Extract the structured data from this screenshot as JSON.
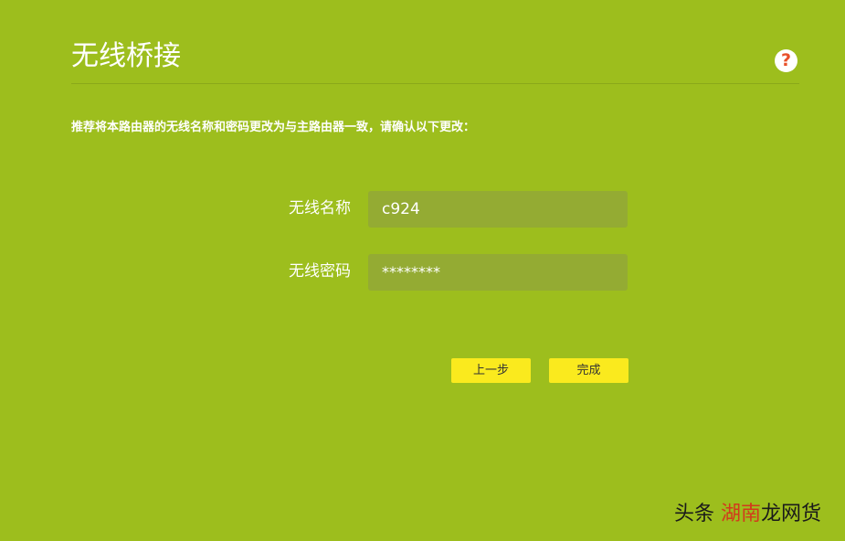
{
  "header": {
    "title": "无线桥接",
    "help_icon": "?"
  },
  "instruction": "推荐将本路由器的无线名称和密码更改为与主路由器一致，请确认以下更改：",
  "form": {
    "ssid_label": "无线名称",
    "ssid_value": "c924",
    "password_label": "无线密码",
    "password_value": "********"
  },
  "buttons": {
    "prev_label": "上一步",
    "done_label": "完成"
  },
  "watermark": {
    "text_prefix": "头条 ",
    "text_accent": "湖南",
    "text_suffix": "龙网货"
  },
  "colors": {
    "background": "#9dbe1d",
    "input_bg": "#94ab33",
    "button_bg": "#faea1e",
    "help_icon": "#e8502a"
  }
}
